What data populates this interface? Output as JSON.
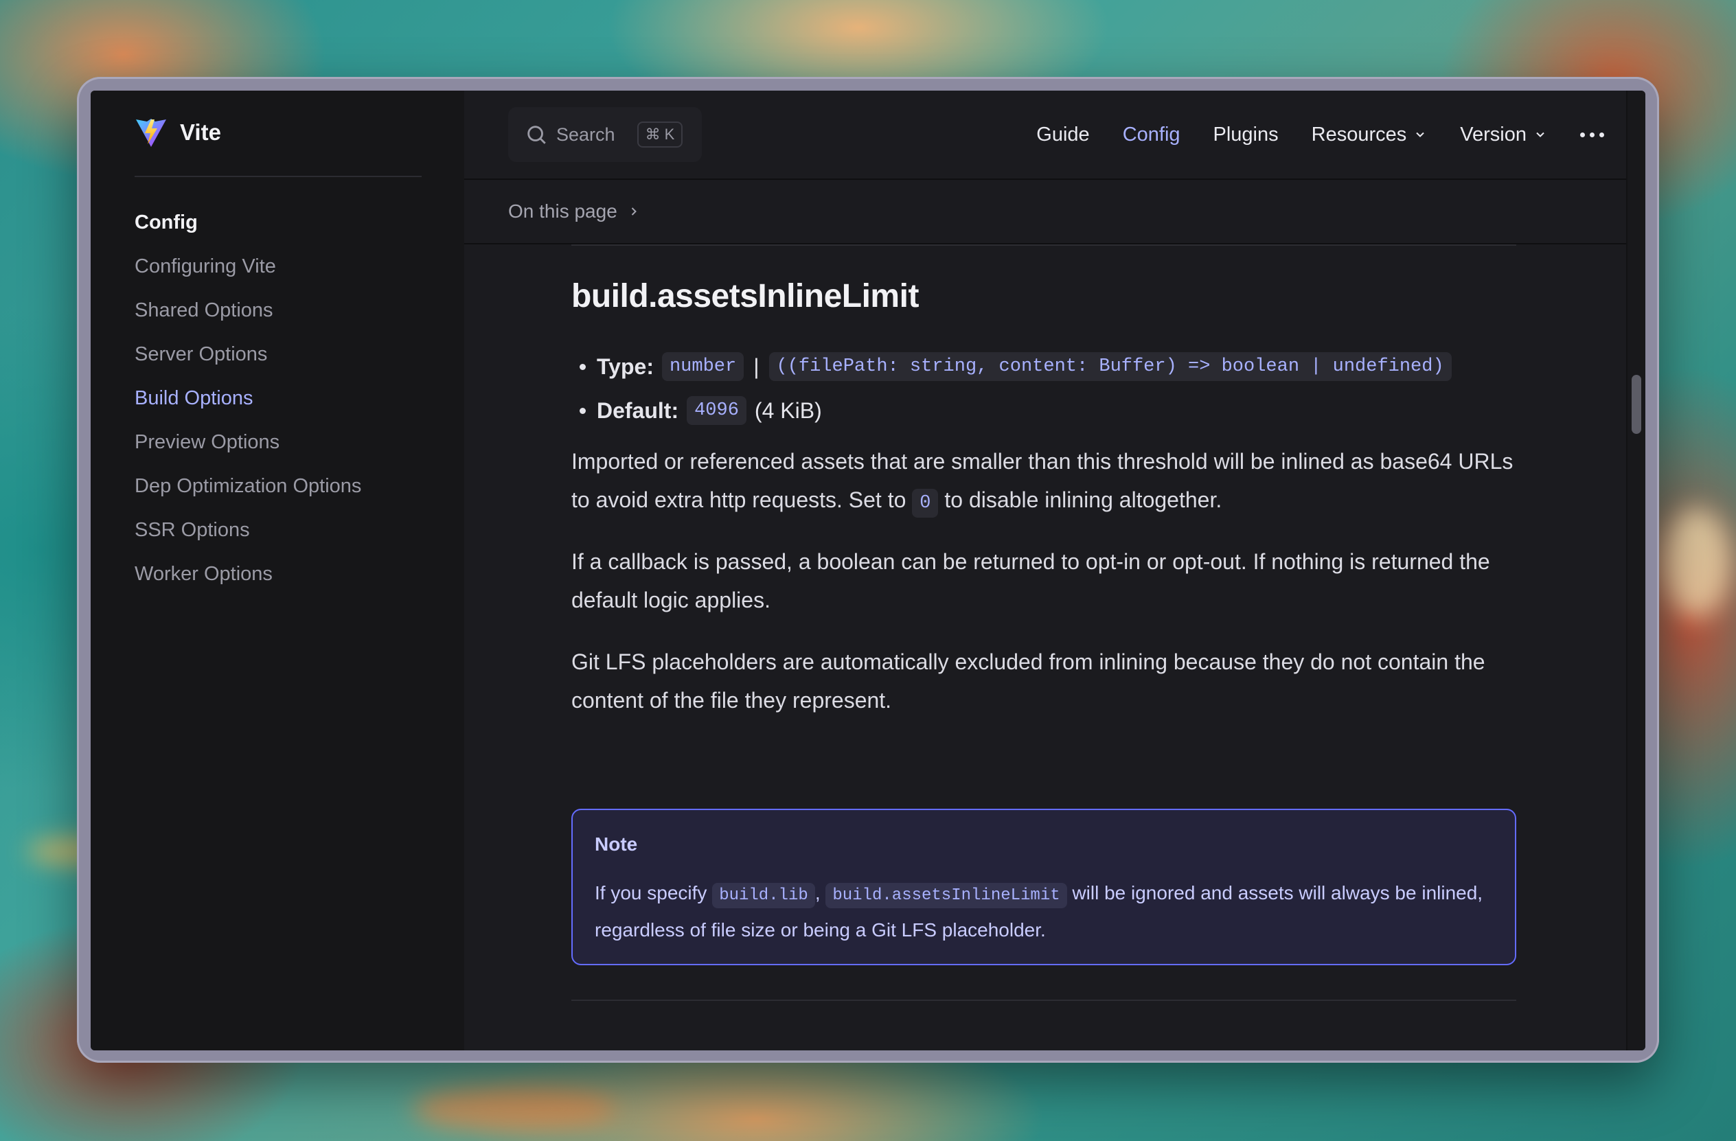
{
  "app": {
    "name": "Vite"
  },
  "search": {
    "label": "Search",
    "shortcut": "⌘ K"
  },
  "nav": {
    "items": [
      {
        "label": "Guide"
      },
      {
        "label": "Config",
        "active": true
      },
      {
        "label": "Plugins"
      },
      {
        "label": "Resources"
      },
      {
        "label": "Version"
      }
    ]
  },
  "on_this_page": "On this page",
  "sidebar": {
    "title": "Config",
    "items": [
      {
        "label": "Configuring Vite"
      },
      {
        "label": "Shared Options"
      },
      {
        "label": "Server Options"
      },
      {
        "label": "Build Options",
        "active": true
      },
      {
        "label": "Preview Options"
      },
      {
        "label": "Dep Optimization Options"
      },
      {
        "label": "SSR Options"
      },
      {
        "label": "Worker Options"
      }
    ]
  },
  "content": {
    "heading": "build.assetsInlineLimit",
    "type_label": "Type:",
    "type_value_1": "number",
    "type_separator": "|",
    "type_value_2": "((filePath: string, content: Buffer) => boolean | undefined)",
    "default_label": "Default:",
    "default_value": "4096",
    "default_suffix": "(4 KiB)",
    "p1_part1": "Imported or referenced assets that are smaller than this threshold will be inlined as base64 URLs to avoid extra http requests. Set to ",
    "p1_code": "0",
    "p1_part2": " to disable inlining altogether.",
    "p2": "If a callback is passed, a boolean can be returned to opt-in or opt-out. If nothing is returned the default logic applies.",
    "p3": "Git LFS placeholders are automatically excluded from inlining because they do not contain the content of the file they represent.",
    "note": {
      "title": "Note",
      "text_before": "If you specify ",
      "code1": "build.lib",
      "separator": ", ",
      "code2": "build.assetsInlineLimit",
      "text_after": " will be ignored and assets will always be inlined, regardless of file size or being a Git LFS placeholder."
    }
  },
  "colors": {
    "accent": "#a8b1ff",
    "note_border": "#646cff",
    "background": "#1b1b1f",
    "sidebar": "#161618"
  },
  "icons": [
    "vite-logo-icon",
    "search-icon",
    "chevron-down-icon",
    "chevron-right-icon",
    "more-icon"
  ]
}
